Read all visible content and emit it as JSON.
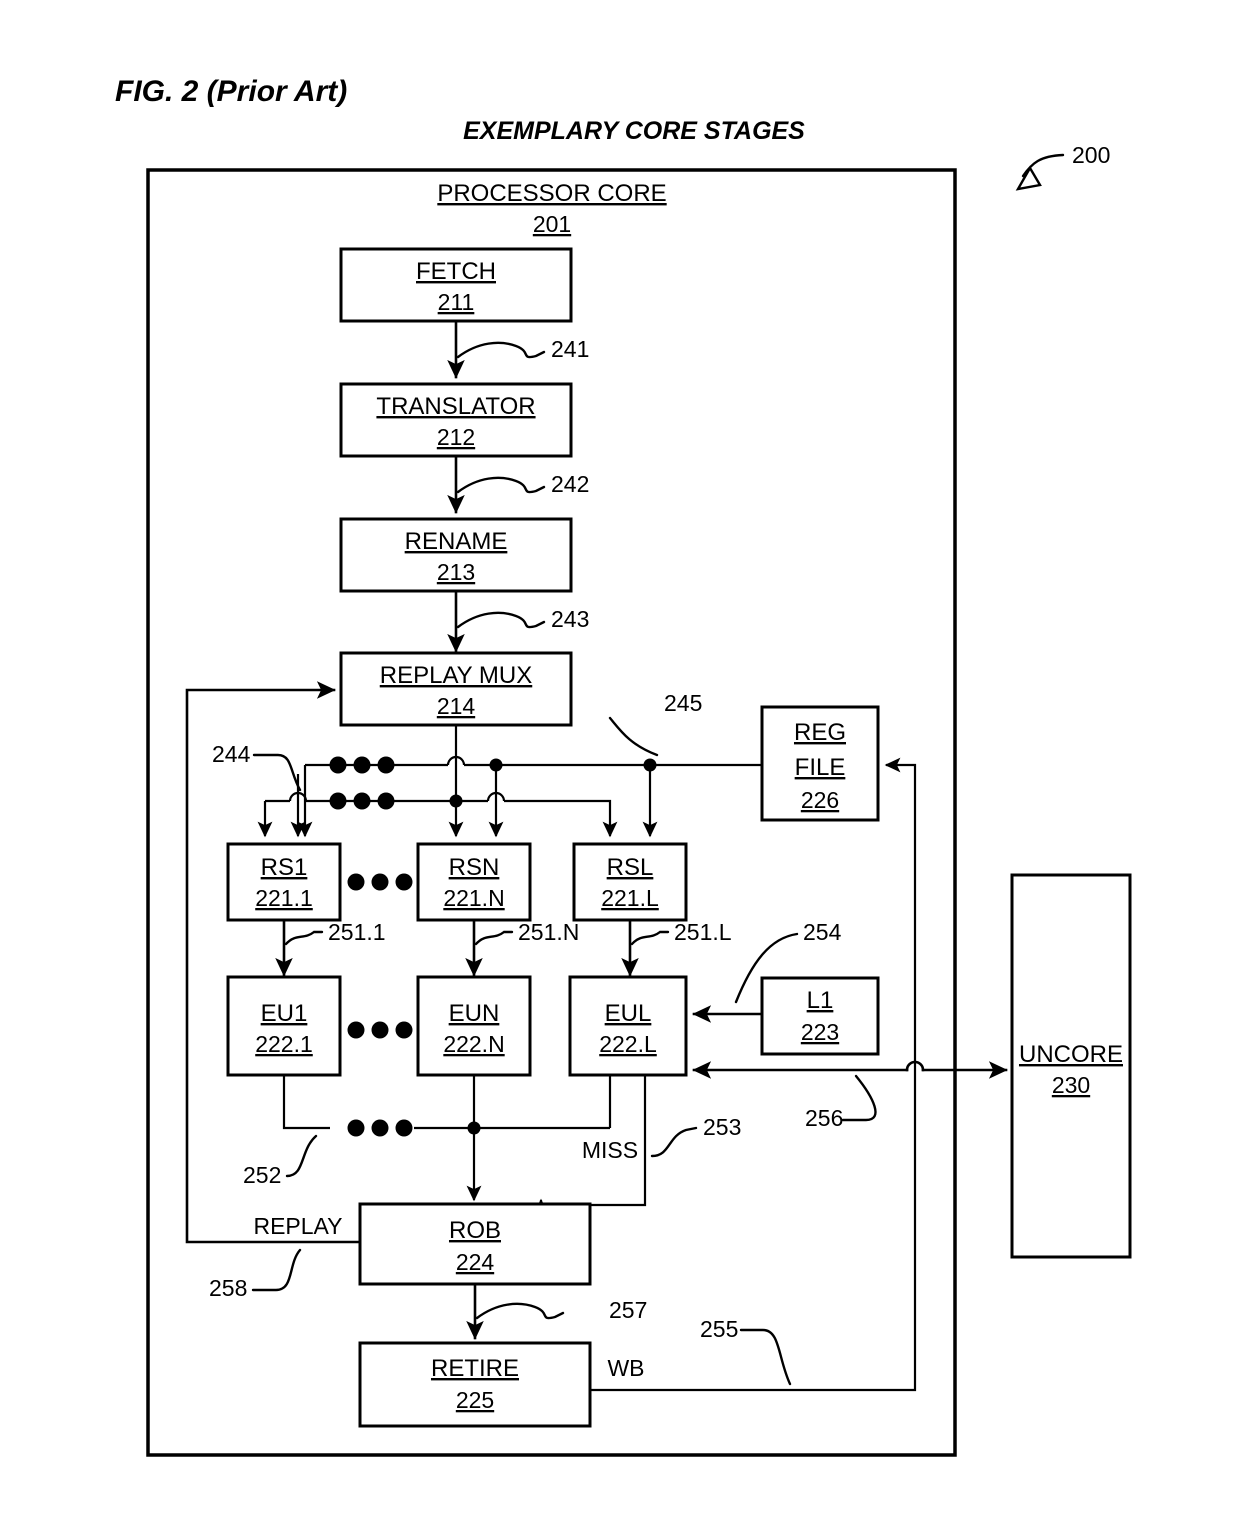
{
  "figure": {
    "title": "FIG. 2 (Prior Art)",
    "subtitle": "EXEMPLARY CORE STAGES",
    "system_ref": "200"
  },
  "core": {
    "title": "PROCESSOR CORE",
    "ref": "201"
  },
  "blocks": [
    {
      "id": "fetch",
      "label": "FETCH",
      "ref": "211"
    },
    {
      "id": "translator",
      "label": "TRANSLATOR",
      "ref": "212"
    },
    {
      "id": "rename",
      "label": "RENAME",
      "ref": "213"
    },
    {
      "id": "replay_mux",
      "label": "REPLAY MUX",
      "ref": "214"
    },
    {
      "id": "rs1",
      "label": "RS1",
      "ref": "221.1"
    },
    {
      "id": "rsn",
      "label": "RSN",
      "ref": "221.N"
    },
    {
      "id": "rsl",
      "label": "RSL",
      "ref": "221.L"
    },
    {
      "id": "eu1",
      "label": "EU1",
      "ref": "222.1"
    },
    {
      "id": "eun",
      "label": "EUN",
      "ref": "222.N"
    },
    {
      "id": "eul",
      "label": "EUL",
      "ref": "222.L"
    },
    {
      "id": "l1",
      "label": "L1",
      "ref": "223"
    },
    {
      "id": "rob",
      "label": "ROB",
      "ref": "224"
    },
    {
      "id": "retire",
      "label": "RETIRE",
      "ref": "225"
    },
    {
      "id": "regfile_1",
      "label": "REG",
      "ref": ""
    },
    {
      "id": "regfile_2",
      "label": "FILE",
      "ref": "226"
    },
    {
      "id": "uncore",
      "label": "UNCORE",
      "ref": "230"
    }
  ],
  "connector_refs": {
    "fetch_to_translator": "241",
    "translator_to_rename": "242",
    "rename_to_replay_mux": "243",
    "operand_bus": "244",
    "regfile_read_bus": "245",
    "rs1_to_eu1": "251.1",
    "rsn_to_eun": "251.N",
    "rsl_to_eul": "251.L",
    "eu_result_bus": "252",
    "miss_signal": "253",
    "l1_to_eul": "254",
    "writeback": "255",
    "eul_to_uncore": "256",
    "rob_to_retire": "257",
    "replay_signal": "258"
  },
  "signal_labels": {
    "miss": "MISS",
    "replay": "REPLAY",
    "writeback": "WB"
  }
}
